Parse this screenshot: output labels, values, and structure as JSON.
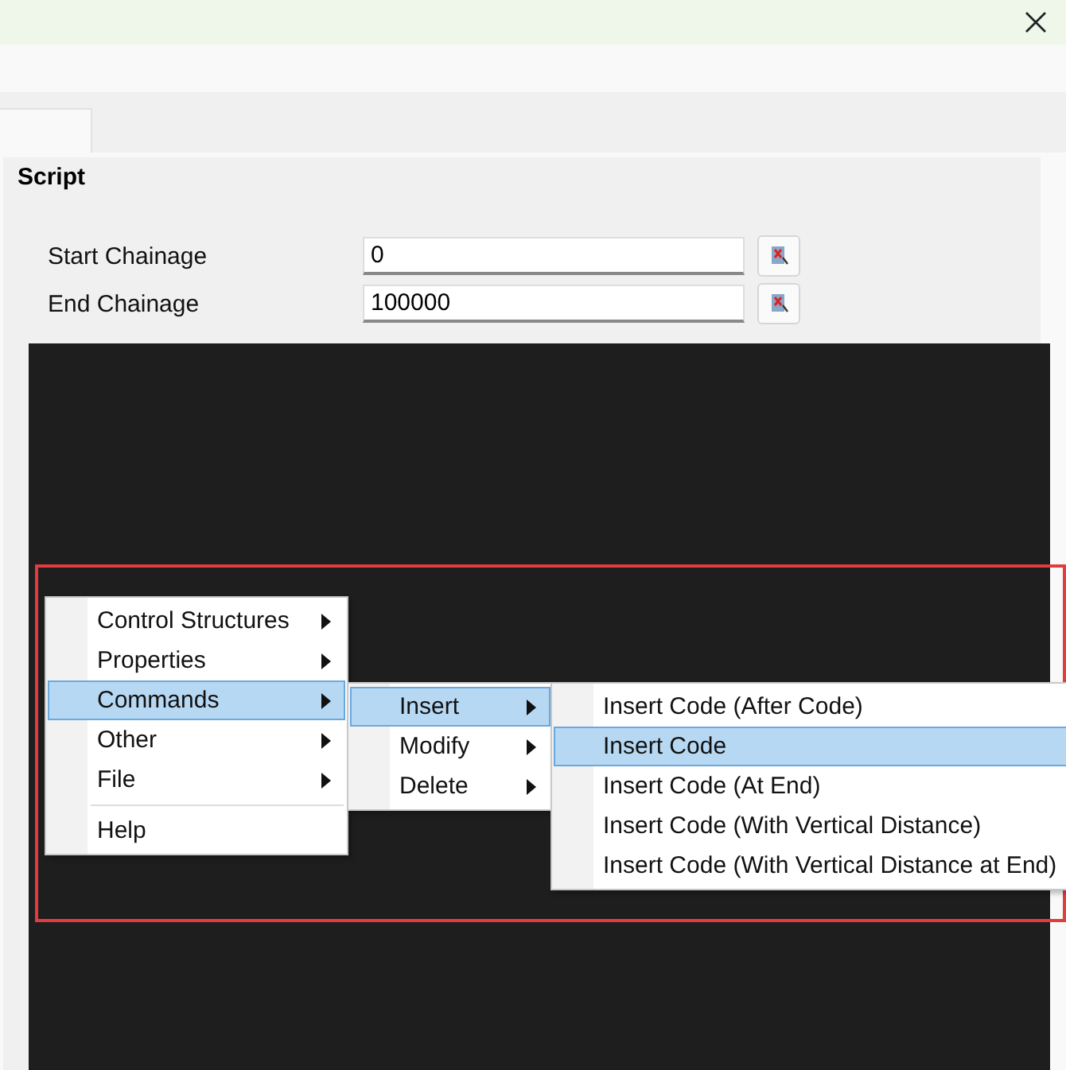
{
  "tab": {
    "selected": true
  },
  "group": {
    "title": "Script"
  },
  "fields": [
    {
      "label": "Start Chainage",
      "value": "0"
    },
    {
      "label": "End Chainage",
      "value": "100000"
    }
  ],
  "menus": [
    {
      "items": [
        {
          "kind": "item",
          "label": "Control Structures",
          "submenu": true,
          "selected": false
        },
        {
          "kind": "item",
          "label": "Properties",
          "submenu": true,
          "selected": false
        },
        {
          "kind": "item",
          "label": "Commands",
          "submenu": true,
          "selected": true
        },
        {
          "kind": "item",
          "label": "Other",
          "submenu": true,
          "selected": false
        },
        {
          "kind": "item",
          "label": "File",
          "submenu": true,
          "selected": false
        },
        {
          "kind": "separator"
        },
        {
          "kind": "item",
          "label": "Help",
          "submenu": false,
          "selected": false
        }
      ]
    },
    {
      "items": [
        {
          "kind": "item",
          "label": "Insert",
          "submenu": true,
          "selected": true
        },
        {
          "kind": "item",
          "label": "Modify",
          "submenu": true,
          "selected": false
        },
        {
          "kind": "item",
          "label": "Delete",
          "submenu": true,
          "selected": false
        }
      ]
    },
    {
      "items": [
        {
          "kind": "item",
          "label": "Insert Code (After Code)",
          "selected": false
        },
        {
          "kind": "item",
          "label": "Insert Code",
          "selected": true
        },
        {
          "kind": "item",
          "label": "Insert Code (At End)",
          "selected": false
        },
        {
          "kind": "item",
          "label": "Insert Code (With Vertical Distance)",
          "selected": false
        },
        {
          "kind": "item",
          "label": "Insert Code (With Vertical Distance at End)",
          "selected": false
        }
      ]
    }
  ]
}
